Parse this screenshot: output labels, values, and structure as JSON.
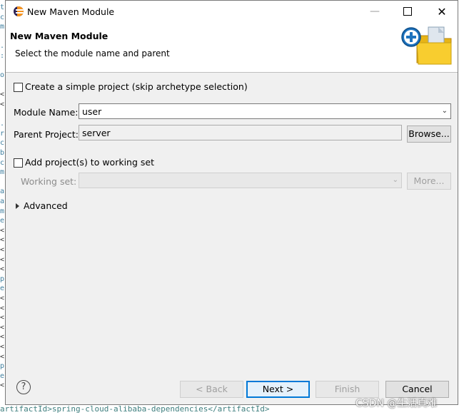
{
  "background": {
    "left_glyphs": [
      "t",
      "c",
      "m",
      "",
      "..",
      ":",
      "",
      "o",
      "",
      "<",
      "<",
      "",
      "..",
      "r",
      "c",
      "b",
      "c",
      "m",
      "",
      "a",
      "a",
      "m",
      "e",
      "<",
      "<",
      "<",
      "<",
      "<",
      "p",
      "e",
      "<",
      "<",
      "<",
      "<",
      "<",
      "<",
      "<",
      "p",
      "e",
      "<"
    ],
    "bottom_text": "artifactId>spring-cloud-alibaba-dependencies</artifactId>"
  },
  "window": {
    "title": "New Maven Module",
    "minimize_icon": "minimize-icon",
    "maximize_icon": "maximize-icon",
    "close_icon": "close-icon",
    "close_glyph": "✕"
  },
  "banner": {
    "title": "New Maven Module",
    "description": "Select the module name and parent"
  },
  "form": {
    "simple_project": {
      "label": "Create a simple project (skip archetype selection)",
      "checked": false
    },
    "module_name": {
      "label": "Module Name:",
      "value": "user"
    },
    "parent_project": {
      "label": "Parent Project:",
      "value": "server",
      "browse_label": "Browse..."
    },
    "working_set_toggle": {
      "label": "Add project(s) to working set",
      "checked": false
    },
    "working_set": {
      "label": "Working set:",
      "value": "",
      "more_label": "More..."
    },
    "advanced": {
      "label": "Advanced",
      "expanded": false
    }
  },
  "footer": {
    "help_glyph": "?",
    "back_label": "< Back",
    "next_label": "Next >",
    "finish_label": "Finish",
    "cancel_label": "Cancel"
  },
  "watermark": "CSDN @生活真难",
  "colors": {
    "dialog_bg": "#f0f0f0",
    "default_button_border": "#0078d7",
    "folder_yellow": "#f5c518",
    "plus_blue": "#1e73be"
  }
}
